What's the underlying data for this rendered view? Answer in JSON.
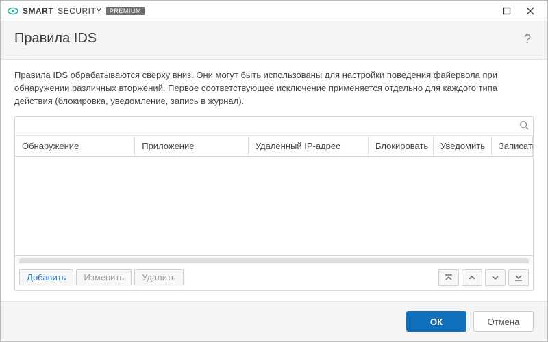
{
  "brand": {
    "company": "eset",
    "smart": "SMART",
    "security": "SECURITY",
    "badge": "PREMIUM"
  },
  "header": {
    "title": "Правила IDS",
    "help_label": "?"
  },
  "description": "Правила IDS обрабатываются сверху вниз. Они могут быть использованы для настройки поведения файервола при обнаружении различных вторжений. Первое соответствующее исключение применяется отдельно для каждого типа действия (блокировка, уведомление, запись в журнал).",
  "search": {
    "placeholder": ""
  },
  "table": {
    "columns": {
      "detection": "Обнаружение",
      "application": "Приложение",
      "remote_ip": "Удаленный IP-адрес",
      "block": "Блокировать",
      "notify": "Уведомить",
      "log": "Записать в ж"
    },
    "rows": []
  },
  "actions": {
    "add": "Добавить",
    "edit": "Изменить",
    "delete": "Удалить"
  },
  "footer": {
    "ok": "ОК",
    "cancel": "Отмена"
  }
}
